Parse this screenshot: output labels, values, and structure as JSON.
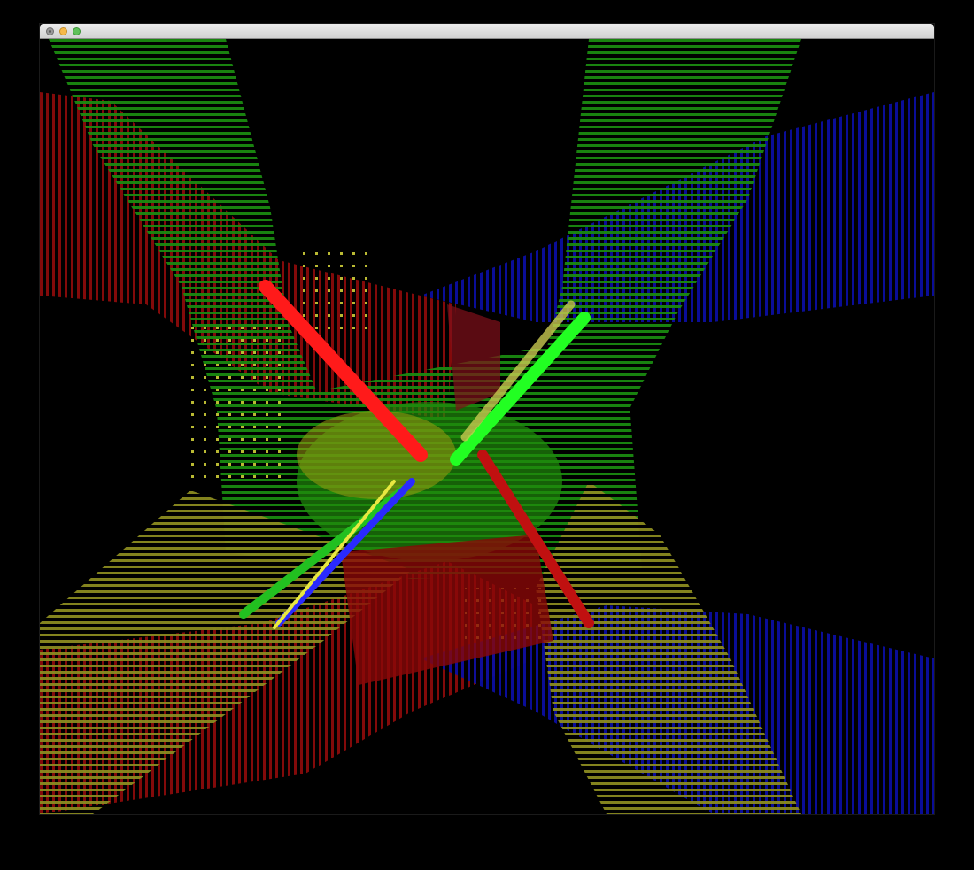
{
  "window": {
    "title": "",
    "controls": [
      {
        "name": "close-button",
        "icon": "close-icon",
        "color": "#9a9a9a"
      },
      {
        "name": "minimize-button",
        "icon": "minimize-icon",
        "color": "#f5b94a"
      },
      {
        "name": "zoom-button",
        "icon": "zoom-icon",
        "color": "#5fc15a"
      }
    ]
  },
  "scene": {
    "description_type": "point-cloud-3d-viewer",
    "background": "#000000",
    "clouds": [
      {
        "name": "green-cloud",
        "color": "#1a8a10"
      },
      {
        "name": "red-cloud",
        "color": "#8a0a0a"
      },
      {
        "name": "blue-cloud",
        "color": "#0a0ea0"
      },
      {
        "name": "yellow-cloud",
        "color": "#8a8a20"
      }
    ],
    "axes": [
      {
        "name": "red-axis",
        "color": "#ff1a1a"
      },
      {
        "name": "green-axis",
        "color": "#22ff22"
      },
      {
        "name": "blue-axis",
        "color": "#2a2aff"
      },
      {
        "name": "yellow-axis",
        "color": "#e8e840"
      }
    ]
  }
}
